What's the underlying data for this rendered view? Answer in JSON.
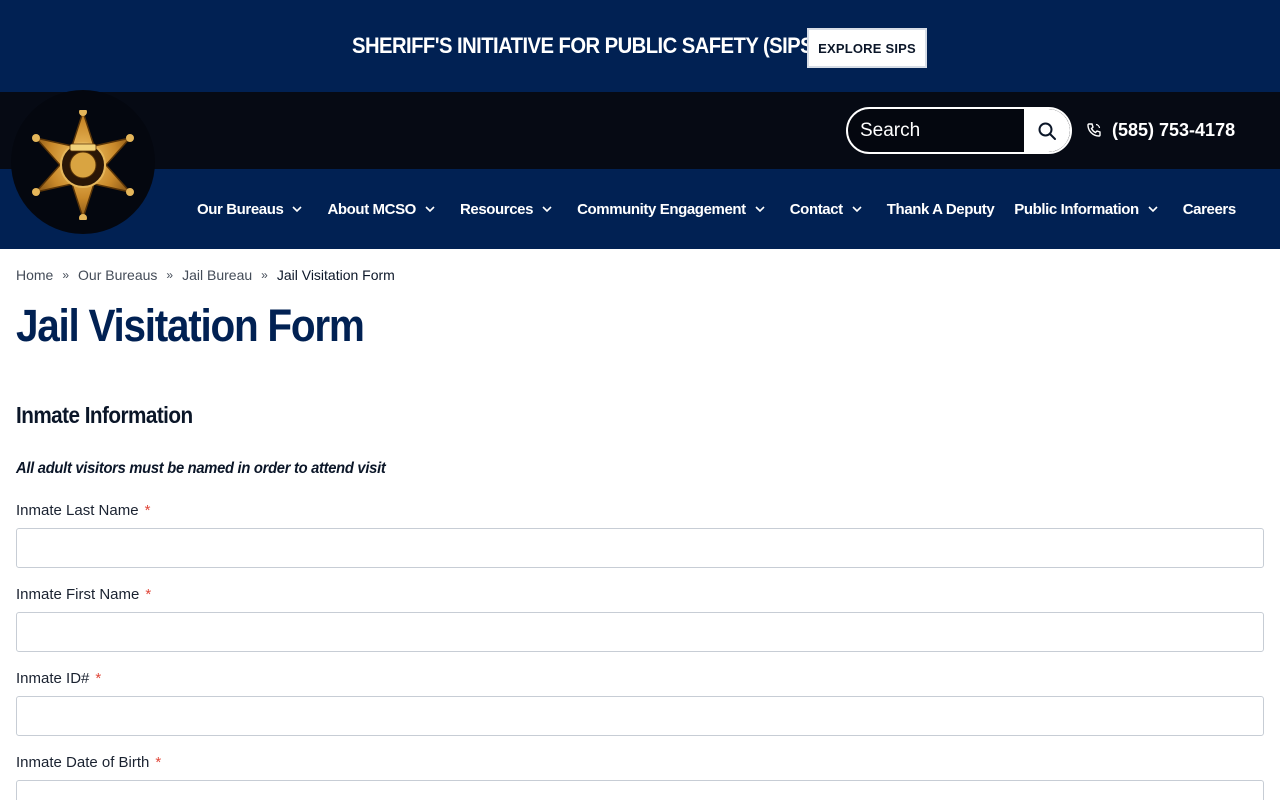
{
  "promo": {
    "text": "SHERIFF'S INITIATIVE FOR PUBLIC SAFETY (SIPS)",
    "button_label": "EXPLORE SIPS"
  },
  "header": {
    "badge_icon": "sheriff-star-badge-icon",
    "search": {
      "placeholder": "Search",
      "value": ""
    },
    "phone": "(585) 753-4178"
  },
  "nav": {
    "items": [
      {
        "label": "Our Bureaus",
        "has_dropdown": true
      },
      {
        "label": "About MCSO",
        "has_dropdown": true
      },
      {
        "label": "Resources",
        "has_dropdown": true
      },
      {
        "label": "Community Engagement",
        "has_dropdown": true
      },
      {
        "label": "Contact",
        "has_dropdown": true
      },
      {
        "label": "Thank A Deputy",
        "has_dropdown": false
      },
      {
        "label": "Public Information",
        "has_dropdown": true
      },
      {
        "label": "Careers",
        "has_dropdown": false
      }
    ]
  },
  "breadcrumb": {
    "items": [
      "Home",
      "Our Bureaus",
      "Jail Bureau"
    ],
    "separator": "»",
    "current": "Jail Visitation Form"
  },
  "page": {
    "title": "Jail Visitation Form",
    "section_title": "Inmate Information",
    "note": "All adult visitors must be named in order to attend visit"
  },
  "form": {
    "required_marker": "*",
    "fields": [
      {
        "label": "Inmate Last Name",
        "value": ""
      },
      {
        "label": "Inmate First Name",
        "value": ""
      },
      {
        "label": "Inmate ID#",
        "value": ""
      },
      {
        "label": "Inmate Date of Birth",
        "value": ""
      }
    ]
  },
  "colors": {
    "navy": "#012153",
    "black_strip": "#060a14",
    "required": "#e0473a",
    "badge_gold": "#c9892a"
  }
}
